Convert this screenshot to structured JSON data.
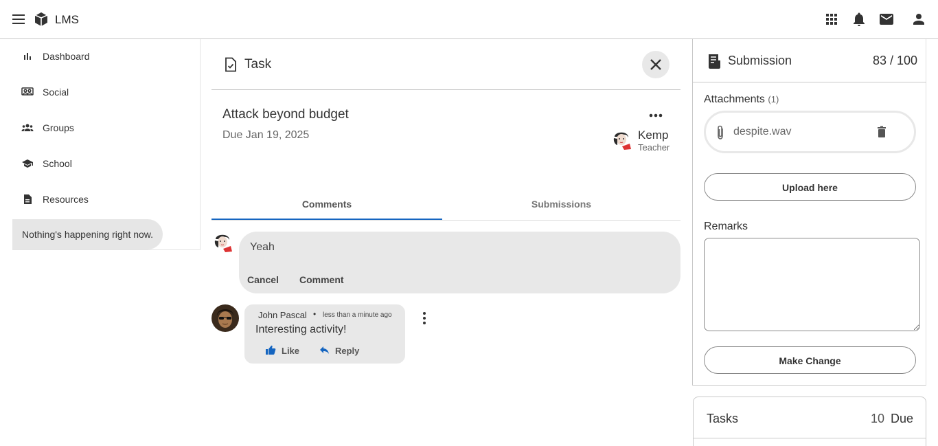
{
  "topbar": {
    "app_title": "LMS",
    "icons": [
      "menu-icon",
      "cube-logo-icon",
      "apps-grid-icon",
      "bell-icon",
      "mail-icon",
      "account-icon"
    ]
  },
  "sidebar": {
    "items": [
      {
        "label": "Dashboard",
        "icon": "bar-chart-icon"
      },
      {
        "label": "Social",
        "icon": "social-icon"
      },
      {
        "label": "Groups",
        "icon": "groups-icon"
      },
      {
        "label": "School",
        "icon": "school-icon"
      },
      {
        "label": "Resources",
        "icon": "resources-icon"
      }
    ],
    "status": "Nothing's happening right now."
  },
  "task": {
    "header": "Task",
    "title": "Attack beyond budget",
    "due": "Due Jan 19, 2025",
    "teacher": {
      "name": "Kemp",
      "role": "Teacher"
    },
    "tabs": {
      "comments": "Comments",
      "submissions": "Submissions"
    },
    "new_comment": {
      "value": "Yeah",
      "cancel": "Cancel",
      "submit": "Comment"
    },
    "comments": [
      {
        "author": "John Pascal",
        "time": "less than a minute ago",
        "text": "Interesting activity!",
        "like": "Like",
        "reply": "Reply"
      }
    ]
  },
  "submission": {
    "title": "Submission",
    "score": "83 / 100",
    "attachments_label": "Attachments",
    "attachments_count": "(1)",
    "file_name": "despite.wav",
    "upload_label": "Upload here",
    "remarks_label": "Remarks",
    "make_change_label": "Make Change"
  },
  "tasks_card": {
    "title": "Tasks",
    "count": "10",
    "due_label": "Due"
  },
  "colors": {
    "accent": "#1565c0",
    "chip_bg": "#e8e8e8"
  }
}
